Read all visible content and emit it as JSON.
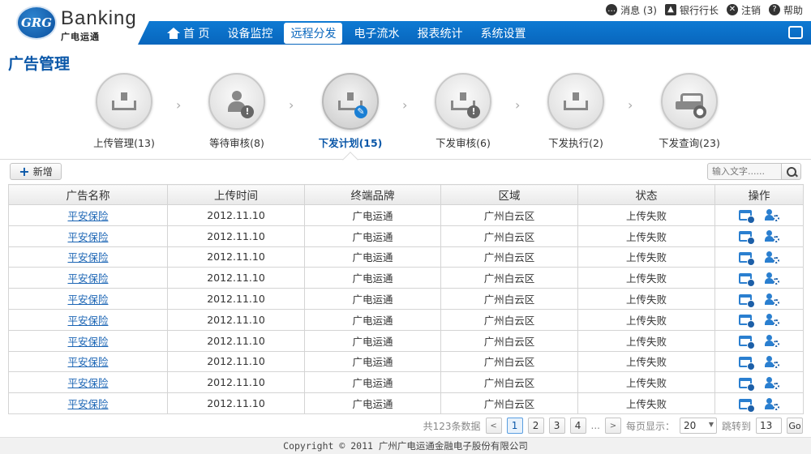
{
  "brand": {
    "logo_text": "GRG",
    "name": "Banking",
    "sub": "广电运通"
  },
  "util": {
    "messages": "消息 (3)",
    "user": "银行行长",
    "logout": "注销",
    "help": "帮助"
  },
  "nav": {
    "items": [
      {
        "label": "首 页",
        "icon": "home-icon",
        "active": false
      },
      {
        "label": "设备监控",
        "active": false
      },
      {
        "label": "远程分发",
        "active": true
      },
      {
        "label": "电子流水",
        "active": false
      },
      {
        "label": "报表统计",
        "active": false
      },
      {
        "label": "系统设置",
        "active": false
      }
    ]
  },
  "page": {
    "title": "广告管理"
  },
  "steps": [
    {
      "label": "上传管理(13)",
      "icon": "upload-tray-icon"
    },
    {
      "label": "等待审核(8)",
      "icon": "user-warning-icon"
    },
    {
      "label": "下发计划(15)",
      "icon": "download-edit-icon",
      "active": true
    },
    {
      "label": "下发审核(6)",
      "icon": "download-warning-icon"
    },
    {
      "label": "下发执行(2)",
      "icon": "download-tray-icon"
    },
    {
      "label": "下发查询(23)",
      "icon": "search-tray-icon"
    }
  ],
  "toolbar": {
    "add_label": "新增",
    "search_placeholder": "输入文字......"
  },
  "table": {
    "columns": [
      "广告名称",
      "上传时间",
      "终端品牌",
      "区域",
      "状态",
      "操作"
    ],
    "rows": [
      {
        "name": "平安保险",
        "time": "2012.11.10",
        "brand": "广电运通",
        "area": "广州白云区",
        "status": "上传失败"
      },
      {
        "name": "平安保险",
        "time": "2012.11.10",
        "brand": "广电运通",
        "area": "广州白云区",
        "status": "上传失败"
      },
      {
        "name": "平安保险",
        "time": "2012.11.10",
        "brand": "广电运通",
        "area": "广州白云区",
        "status": "上传失败"
      },
      {
        "name": "平安保险",
        "time": "2012.11.10",
        "brand": "广电运通",
        "area": "广州白云区",
        "status": "上传失败"
      },
      {
        "name": "平安保险",
        "time": "2012.11.10",
        "brand": "广电运通",
        "area": "广州白云区",
        "status": "上传失败"
      },
      {
        "name": "平安保险",
        "time": "2012.11.10",
        "brand": "广电运通",
        "area": "广州白云区",
        "status": "上传失败"
      },
      {
        "name": "平安保险",
        "time": "2012.11.10",
        "brand": "广电运通",
        "area": "广州白云区",
        "status": "上传失败"
      },
      {
        "name": "平安保险",
        "time": "2012.11.10",
        "brand": "广电运通",
        "area": "广州白云区",
        "status": "上传失败"
      },
      {
        "name": "平安保险",
        "time": "2012.11.10",
        "brand": "广电运通",
        "area": "广州白云区",
        "status": "上传失败"
      },
      {
        "name": "平安保险",
        "time": "2012.11.10",
        "brand": "广电运通",
        "area": "广州白云区",
        "status": "上传失败"
      }
    ]
  },
  "pager": {
    "total": "共123条数据",
    "prev": "<",
    "pages": [
      "1",
      "2",
      "3",
      "4"
    ],
    "current": "1",
    "ellipsis": "...",
    "next": ">",
    "per_page_label": "每页显示：",
    "per_page": "20",
    "jump_label": "跳转到",
    "jump_value": "13",
    "go": "Go"
  },
  "footer": {
    "text": "Copyright © 2011 广州广电运通金融电子股份有限公司"
  }
}
